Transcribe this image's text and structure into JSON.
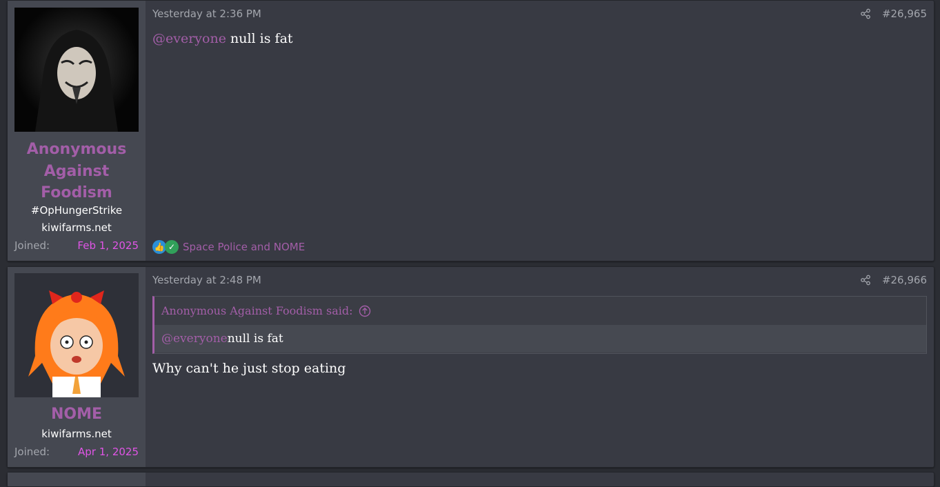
{
  "posts": [
    {
      "username": "Anonymous Against Foodism",
      "user_title": "#OpHungerStrike",
      "site": "kiwifarms.net",
      "joined_label": "Joined:",
      "joined_date": "Feb 1, 2025",
      "date": "Yesterday at 2:36 PM",
      "post_number": "#26,965",
      "body_mention": "@everyone",
      "body_text": " null is fat",
      "reactions_text": "Space Police and NOME",
      "reaction_icons": [
        "like-icon",
        "check-icon"
      ]
    },
    {
      "username": "NOME",
      "site": "kiwifarms.net",
      "joined_label": "Joined:",
      "joined_date": "Apr 1, 2025",
      "date": "Yesterday at 2:48 PM",
      "post_number": "#26,966",
      "quote_author": "Anonymous Against Foodism said:",
      "quote_mention": "@everyone",
      "quote_text": " null is fat",
      "body_text": "Why can't he just stop eating"
    }
  ],
  "colors": {
    "username": "#a35ea8",
    "joined_date": "#e055e6",
    "muted": "#a3a6ad",
    "background": "#2b2d33",
    "post": "#383a43",
    "user_cell": "#454851"
  }
}
